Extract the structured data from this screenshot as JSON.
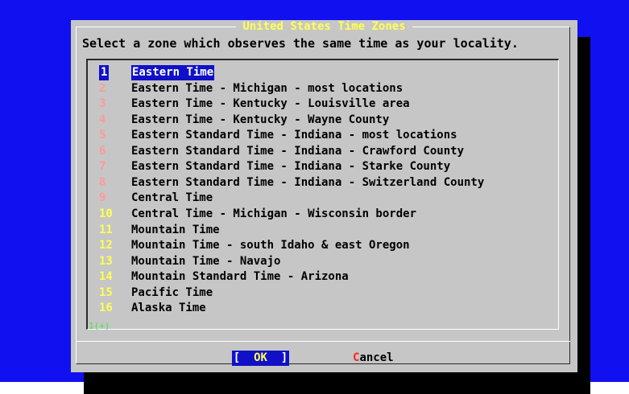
{
  "dialog": {
    "title": "United States Time Zones",
    "prompt": "Select a zone which observes the same time as your locality.",
    "more_indicator": "1(+)",
    "items": [
      {
        "tag": "1",
        "label": "Eastern Time"
      },
      {
        "tag": "2",
        "label": "Eastern Time - Michigan - most locations"
      },
      {
        "tag": "3",
        "label": "Eastern Time - Kentucky - Louisville area"
      },
      {
        "tag": "4",
        "label": "Eastern Time - Kentucky - Wayne County"
      },
      {
        "tag": "5",
        "label": "Eastern Standard Time - Indiana - most locations"
      },
      {
        "tag": "6",
        "label": "Eastern Standard Time - Indiana - Crawford County"
      },
      {
        "tag": "7",
        "label": "Eastern Standard Time - Indiana - Starke County"
      },
      {
        "tag": "8",
        "label": "Eastern Standard Time - Indiana - Switzerland County"
      },
      {
        "tag": "9",
        "label": "Central Time"
      },
      {
        "tag": "10",
        "label": "Central Time - Michigan - Wisconsin border"
      },
      {
        "tag": "11",
        "label": "Mountain Time"
      },
      {
        "tag": "12",
        "label": "Mountain Time - south Idaho & east Oregon"
      },
      {
        "tag": "13",
        "label": "Mountain Time - Navajo"
      },
      {
        "tag": "14",
        "label": "Mountain Standard Time - Arizona"
      },
      {
        "tag": "15",
        "label": "Pacific Time"
      },
      {
        "tag": "16",
        "label": "Alaska Time"
      }
    ],
    "selected_index": 0,
    "buttons": {
      "ok": {
        "left_bracket": "[",
        "hotkey": "OK",
        "right_bracket": "]"
      },
      "cancel": {
        "hotkey": "C",
        "rest": "ancel"
      }
    }
  },
  "colors": {
    "screen_bg": "#1010f0",
    "dialog_bg": "#c6c6c6",
    "title": "#ffff55",
    "selection_bg": "#1010c8",
    "tag_dim": "#ff9999",
    "tag_highlight": "#ffff55",
    "cancel_hotkey": "#ff2222"
  }
}
